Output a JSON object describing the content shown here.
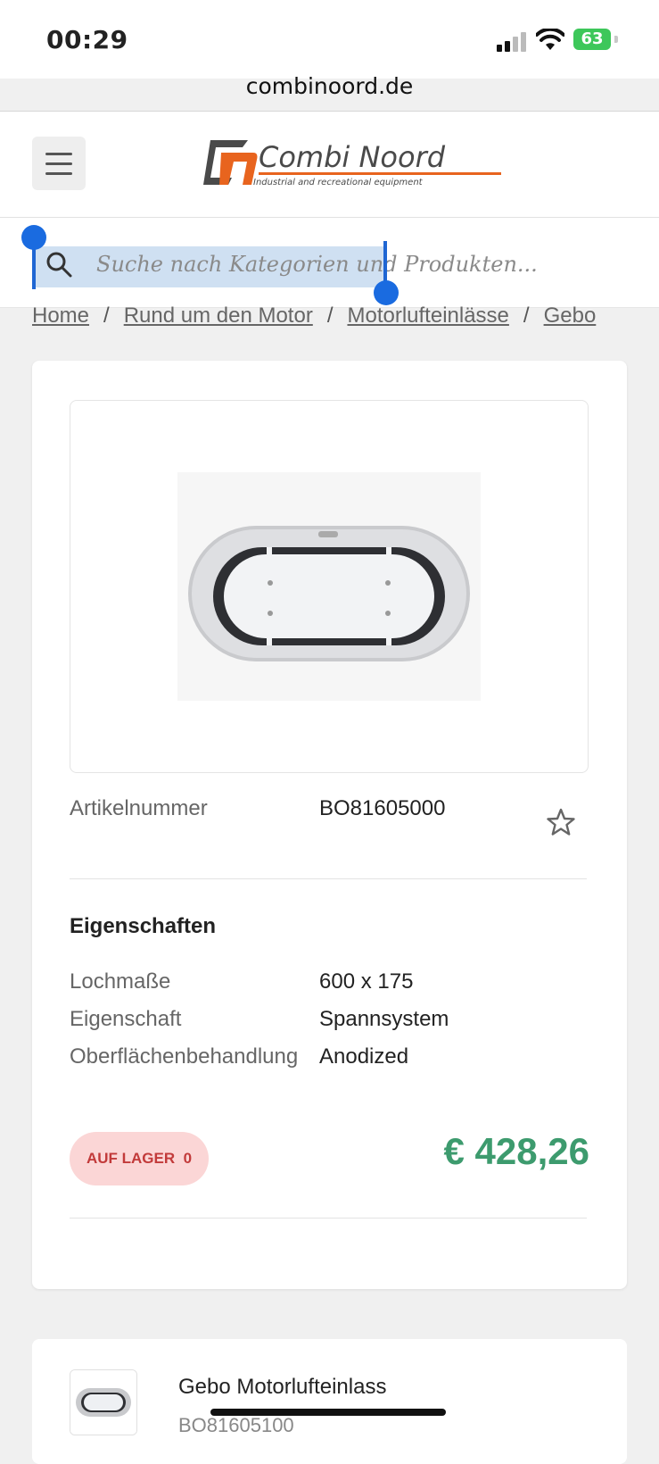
{
  "status": {
    "time": "00:29",
    "battery": "63"
  },
  "browser": {
    "url": "combinoord.de"
  },
  "header": {
    "brand": "Combi Noord",
    "tagline": "Industrial and recreational equipment"
  },
  "search": {
    "placeholder": "Suche nach Kategorien und Produkten..."
  },
  "breadcrumb": [
    "Home",
    "Rund um den Motor",
    "Motorlufteinlässe",
    "Gebo"
  ],
  "product": {
    "sku_label": "Artikelnummer",
    "sku": "BO81605000",
    "properties_title": "Eigenschaften",
    "properties": [
      {
        "label": "Lochmaße",
        "value": "600 x 175"
      },
      {
        "label": "Eigenschaft",
        "value": "Spannsystem"
      },
      {
        "label": "Oberflächenbehandlung",
        "value": "Anodized"
      }
    ],
    "stock_label": "AUF LAGER",
    "stock_count": "0",
    "price": "€ 428,26"
  },
  "related": {
    "title": "Gebo Motorlufteinlass",
    "sku": "BO81605100"
  },
  "colors": {
    "price": "#3d9b6e",
    "stock_bg": "#fbd6d6",
    "stock_text": "#c23a3a",
    "brand_orange": "#e8641e",
    "selection": "#1f66d3"
  }
}
